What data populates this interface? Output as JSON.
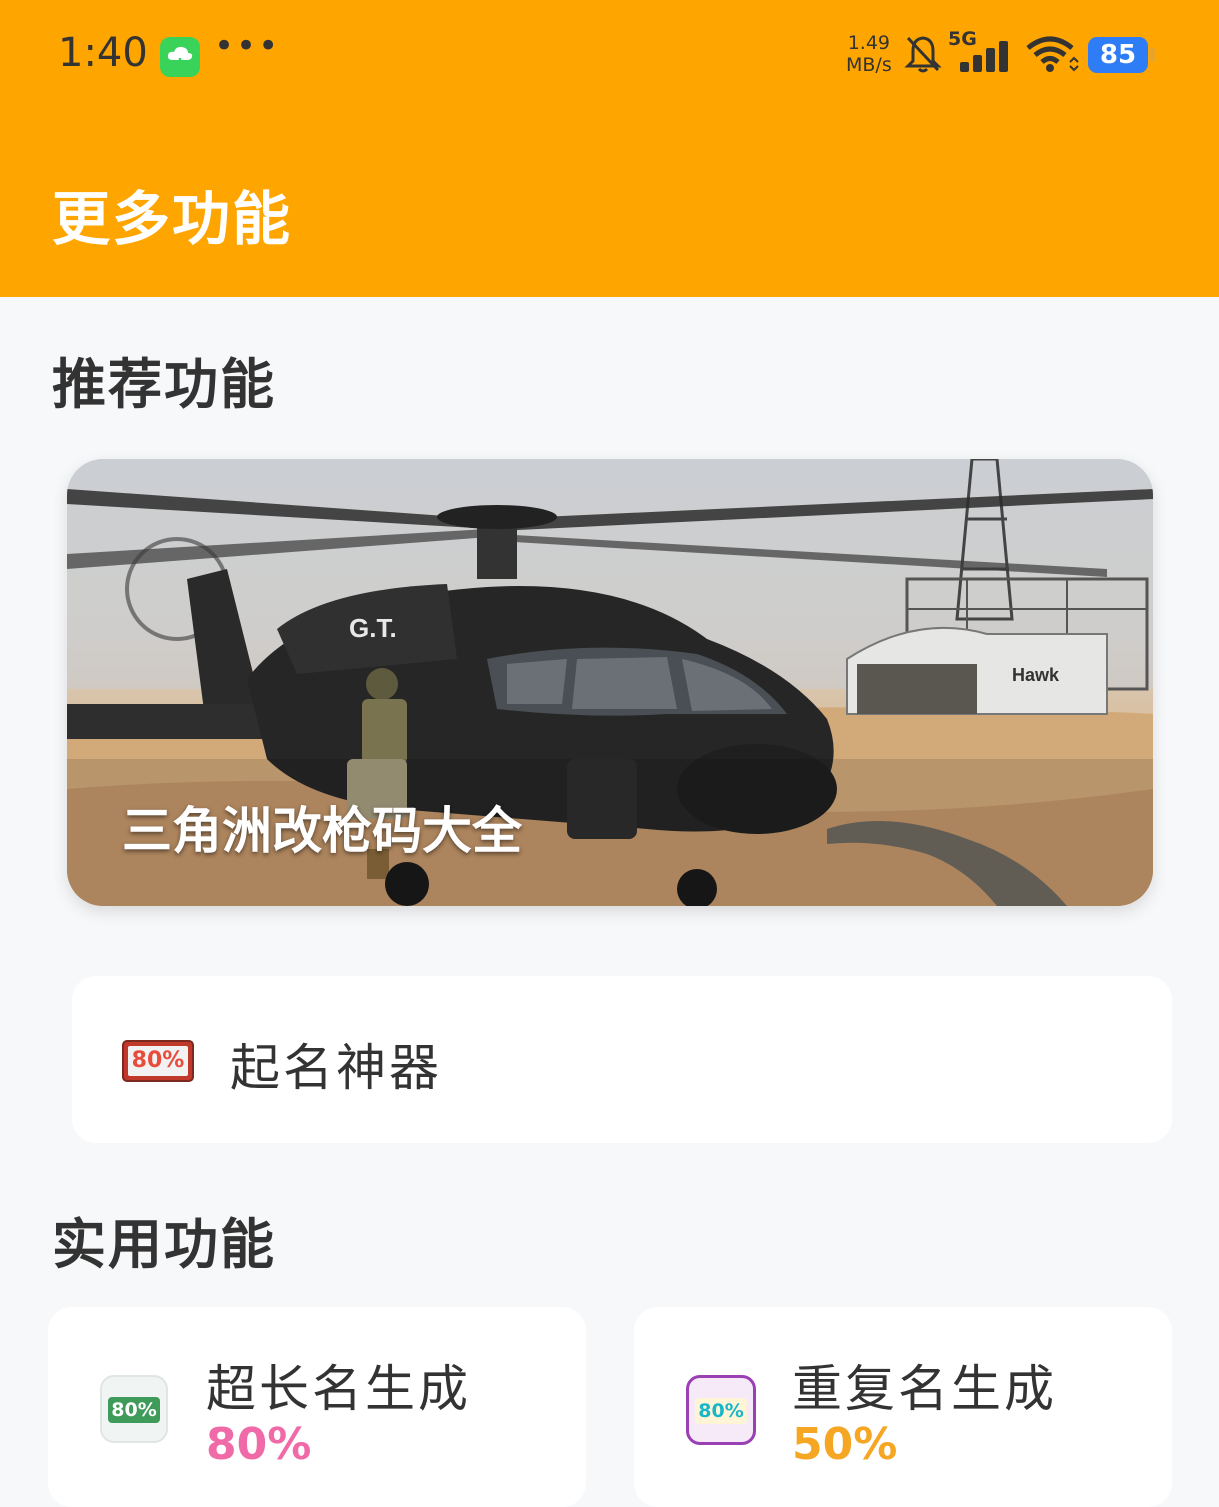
{
  "status_bar": {
    "time": "1:40",
    "speed_value": "1.49",
    "speed_unit": "MB/s",
    "network": "5G",
    "battery": "85"
  },
  "header": {
    "title": "更多功能"
  },
  "recommended": {
    "section_title": "推荐功能",
    "banner_caption": "三角洲改枪码大全",
    "feature_label": "起名神器",
    "feature_icon_text": "80%"
  },
  "utility": {
    "section_title": "实用功能",
    "items": [
      {
        "title": "超长名生成",
        "percent": "80%",
        "icon_text": "80%",
        "color": "#f06aa8"
      },
      {
        "title": "重复名生成",
        "percent": "50%",
        "icon_text": "80%",
        "color": "#f5a623"
      }
    ]
  },
  "colors": {
    "header_bg": "#ffa500",
    "page_bg": "#f7f8fa",
    "battery": "#2f7df6"
  }
}
